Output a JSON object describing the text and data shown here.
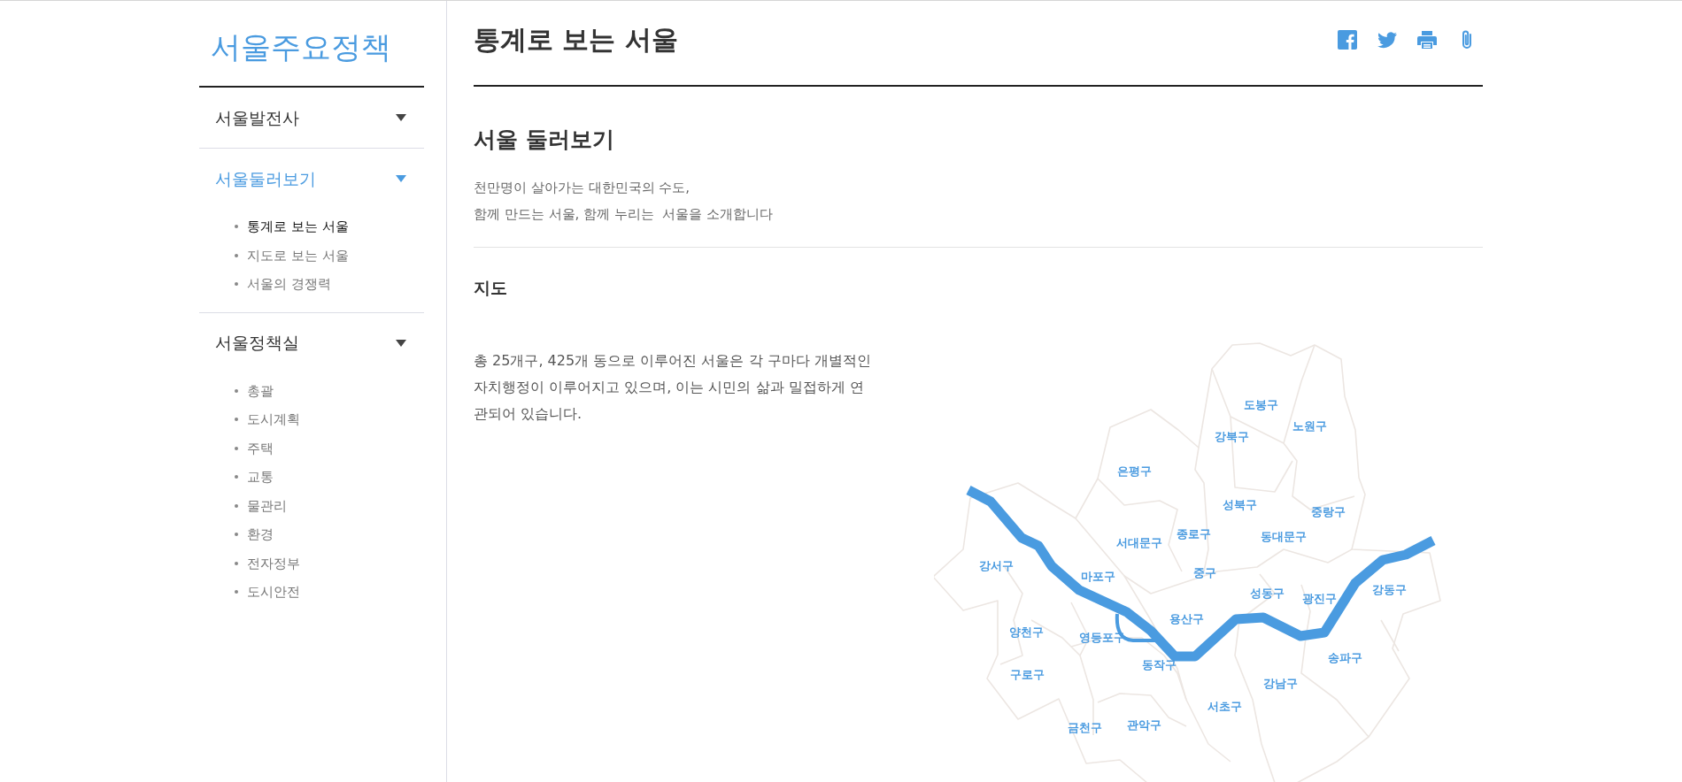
{
  "sidebar": {
    "title": "서울주요정책",
    "groups": [
      {
        "label": "서울발전사",
        "selected": false
      },
      {
        "label": "서울둘러보기",
        "selected": true,
        "children": [
          {
            "label": "통계로 보는 서울",
            "selected": true
          },
          {
            "label": "지도로 보는 서울",
            "selected": false
          },
          {
            "label": "서울의 경쟁력",
            "selected": false
          }
        ]
      },
      {
        "label": "서울정책실",
        "selected": false,
        "children": [
          {
            "label": "총괄",
            "selected": false
          },
          {
            "label": "도시계획",
            "selected": false
          },
          {
            "label": "주택",
            "selected": false
          },
          {
            "label": "교통",
            "selected": false
          },
          {
            "label": "물관리",
            "selected": false
          },
          {
            "label": "환경",
            "selected": false
          },
          {
            "label": "전자정부",
            "selected": false
          },
          {
            "label": "도시안전",
            "selected": false
          }
        ]
      }
    ]
  },
  "page_title": "통계로 보는 서울",
  "share_icons": [
    {
      "kind": "facebook"
    },
    {
      "kind": "twitter"
    },
    {
      "kind": "print"
    },
    {
      "kind": "attach"
    }
  ],
  "section_title": "서울 둘러보기",
  "intro_lines": [
    "천만명이 살아가는 대한민국의 수도,",
    "함께 만드는 서울, 함께 누리는  서울을 소개합니다"
  ],
  "map_section": {
    "title": "지도",
    "description": "총 25개구, 425개 동으로 이루어진 서울은 각 구마다 개별적인 자치행정이 이루어지고 있으며, 이는 시민의 삶과 밀접하게 연관되어 있습니다.",
    "districts": [
      "도봉구",
      "노원구",
      "강북구",
      "은평구",
      "성북구",
      "중랑구",
      "서대문구",
      "종로구",
      "동대문구",
      "강서구",
      "마포구",
      "중구",
      "성동구",
      "광진구",
      "강동구",
      "용산구",
      "양천구",
      "영등포구",
      "동작구",
      "송파구",
      "구로구",
      "강남구",
      "서초구",
      "금천구",
      "관악구"
    ]
  }
}
